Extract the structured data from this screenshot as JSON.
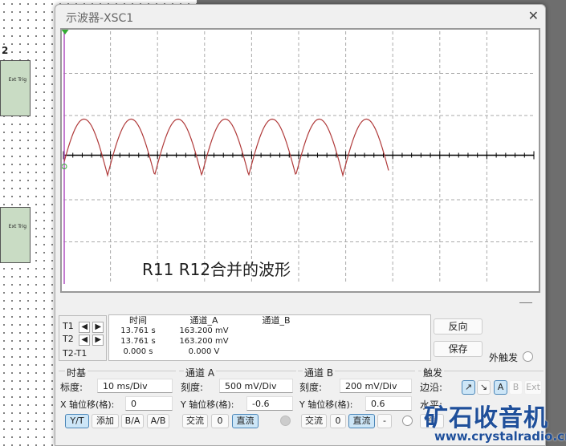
{
  "background": {
    "component_label": "2",
    "ext_trig_1": "Ext Trig",
    "ext_trig_2": "Ext Trig"
  },
  "window": {
    "title": "示波器-XSC1",
    "close": "✕"
  },
  "screen": {
    "caption": "R11 R12合并的波形",
    "trace_color": "#b03a3a"
  },
  "cursors": {
    "t1": "T1",
    "t2": "T2",
    "t2t1": "T2-T1",
    "left": "◀",
    "right": "▶"
  },
  "readout": {
    "headers": [
      "时间",
      "通道_A",
      "通道_B"
    ],
    "rows": [
      [
        "13.761 s",
        "163.200 mV",
        ""
      ],
      [
        "13.761 s",
        "163.200 mV",
        ""
      ],
      [
        "0.000 s",
        "0.000 V",
        ""
      ]
    ]
  },
  "buttons": {
    "reverse": "反向",
    "save": "保存",
    "ext_trigger": "外触发"
  },
  "timebase": {
    "title": "时基",
    "scale_label": "标度:",
    "scale": "10 ms/Div",
    "xpos_label": "X 轴位移(格):",
    "xpos": "0",
    "modes": [
      "Y/T",
      "添加",
      "B/A",
      "A/B"
    ]
  },
  "channel_a": {
    "title": "通道 A",
    "scale_label": "刻度:",
    "scale": "500 mV/Div",
    "ypos_label": "Y 轴位移(格):",
    "ypos": "-0.6",
    "coupling": [
      "交流",
      "0",
      "直流"
    ]
  },
  "channel_b": {
    "title": "通道 B",
    "scale_label": "刻度:",
    "scale": "200 mV/Div",
    "ypos_label": "Y 轴位移(格):",
    "ypos": "0.6",
    "coupling": [
      "交流",
      "0",
      "直流",
      "-"
    ]
  },
  "trigger": {
    "title": "触发",
    "edge_label": "边沿:",
    "level_label": "水平:",
    "edges": [
      "↗",
      "↘"
    ],
    "sources": [
      "A",
      "B",
      "Ext"
    ],
    "mode_first": "单"
  },
  "watermark": {
    "name": "矿石收音机",
    "url": "www.crystalradio.cn"
  }
}
